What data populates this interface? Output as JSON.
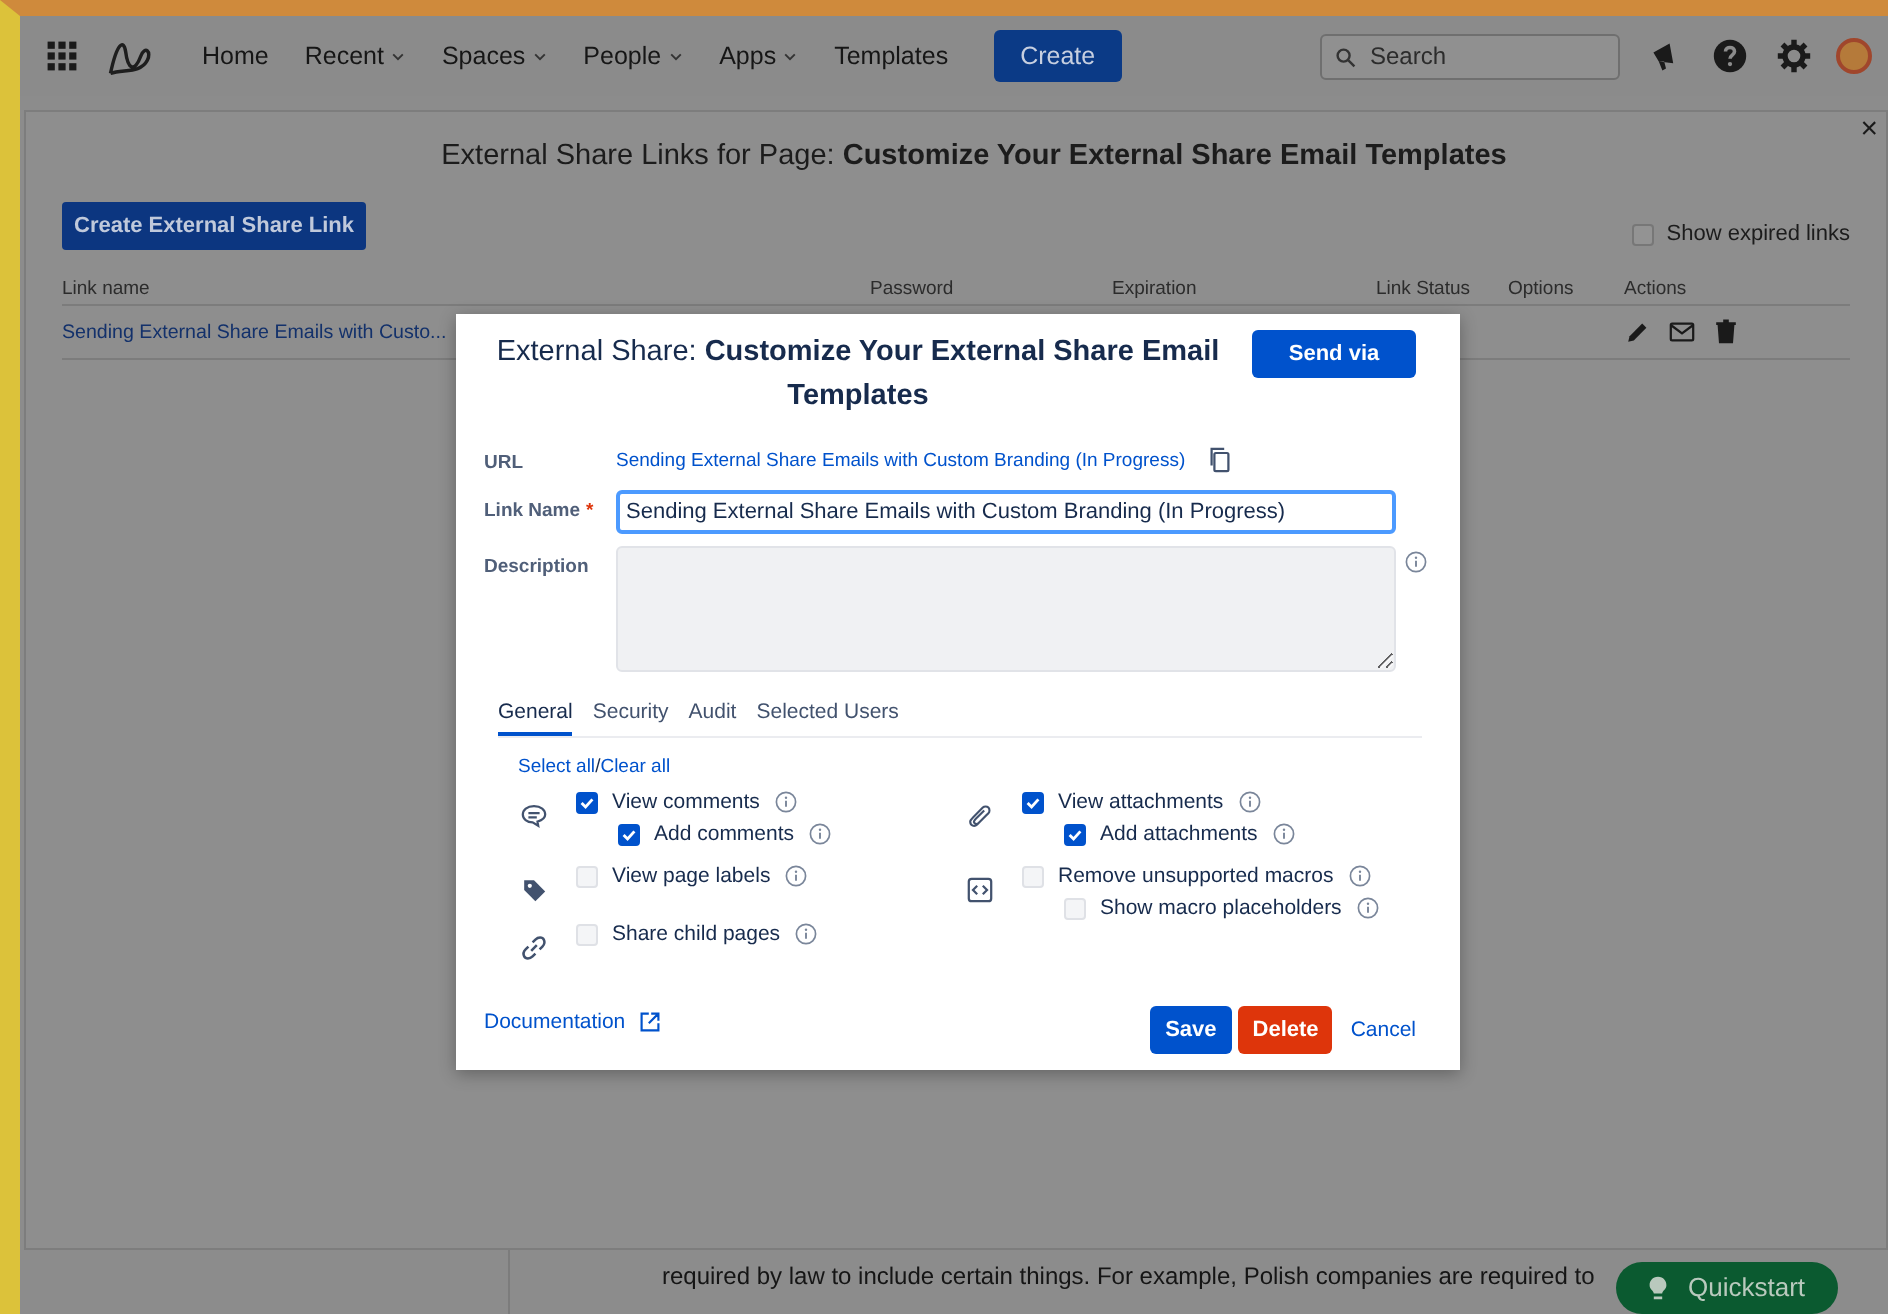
{
  "nav": {
    "items": [
      {
        "label": "Home",
        "caret": false
      },
      {
        "label": "Recent",
        "caret": true
      },
      {
        "label": "Spaces",
        "caret": true
      },
      {
        "label": "People",
        "caret": true
      },
      {
        "label": "Apps",
        "caret": true
      },
      {
        "label": "Templates",
        "caret": false
      }
    ],
    "create_button": "Create",
    "search": {
      "placeholder": "Search"
    }
  },
  "panel": {
    "title": "External Share Links for Page: **Customize Your External Share Email Templates**",
    "close": "×",
    "create_button": "Create External Share Link",
    "show_expired": {
      "label": "Show expired links",
      "checked": false
    },
    "table": {
      "columns": [
        "Link name",
        "Password",
        "Expiration",
        "Link Status",
        "Options",
        "Actions"
      ],
      "rows": [
        {
          "link_name": "Sending External Share Emails with Custo..."
        }
      ]
    }
  },
  "dialog": {
    "title": "External Share: **Customize Your External Share Email Templates**",
    "send_button": "Send via",
    "url": {
      "label": "URL",
      "value": "Sending External Share Emails with Custom Branding (In Progress)"
    },
    "link_name": {
      "label": "Link Name",
      "required_mark": "*",
      "value": "Sending External Share Emails with Custom Branding (In Progress)"
    },
    "description": {
      "label": "Description"
    },
    "tabs": [
      {
        "label": "General",
        "selected": true
      },
      {
        "label": "Security",
        "selected": false
      },
      {
        "label": "Audit",
        "selected": false
      },
      {
        "label": "Selected Users",
        "selected": false
      }
    ],
    "select_all": "Select all",
    "separator": "/",
    "clear_all": "Clear all",
    "columns": [
      [
        {
          "kind": "comment",
          "items": [
            {
              "label": "View comments",
              "checked": true,
              "children": [
                {
                  "label": "Add comments",
                  "checked": true
                }
              ]
            }
          ]
        },
        {
          "kind": "tag",
          "items": [
            {
              "label": "View page labels",
              "checked": false
            }
          ]
        },
        {
          "kind": "link",
          "items": [
            {
              "label": "Share child pages",
              "checked": false
            }
          ]
        }
      ],
      [
        {
          "kind": "paperclip",
          "items": [
            {
              "label": "View attachments",
              "checked": true,
              "children": [
                {
                  "label": "Add attachments",
                  "checked": true
                }
              ]
            }
          ]
        },
        {
          "kind": "code",
          "items": [
            {
              "label": "Remove unsupported macros",
              "checked": false,
              "children": [
                {
                  "label": "Show macro placeholders",
                  "checked": false
                }
              ]
            }
          ]
        }
      ]
    ],
    "documentation": "Documentation",
    "save": "Save",
    "delete": "Delete",
    "cancel": "Cancel"
  },
  "background": {
    "paragraph": "required by law to include certain things. For example, Polish companies are required to",
    "quickstart": "Quickstart"
  }
}
